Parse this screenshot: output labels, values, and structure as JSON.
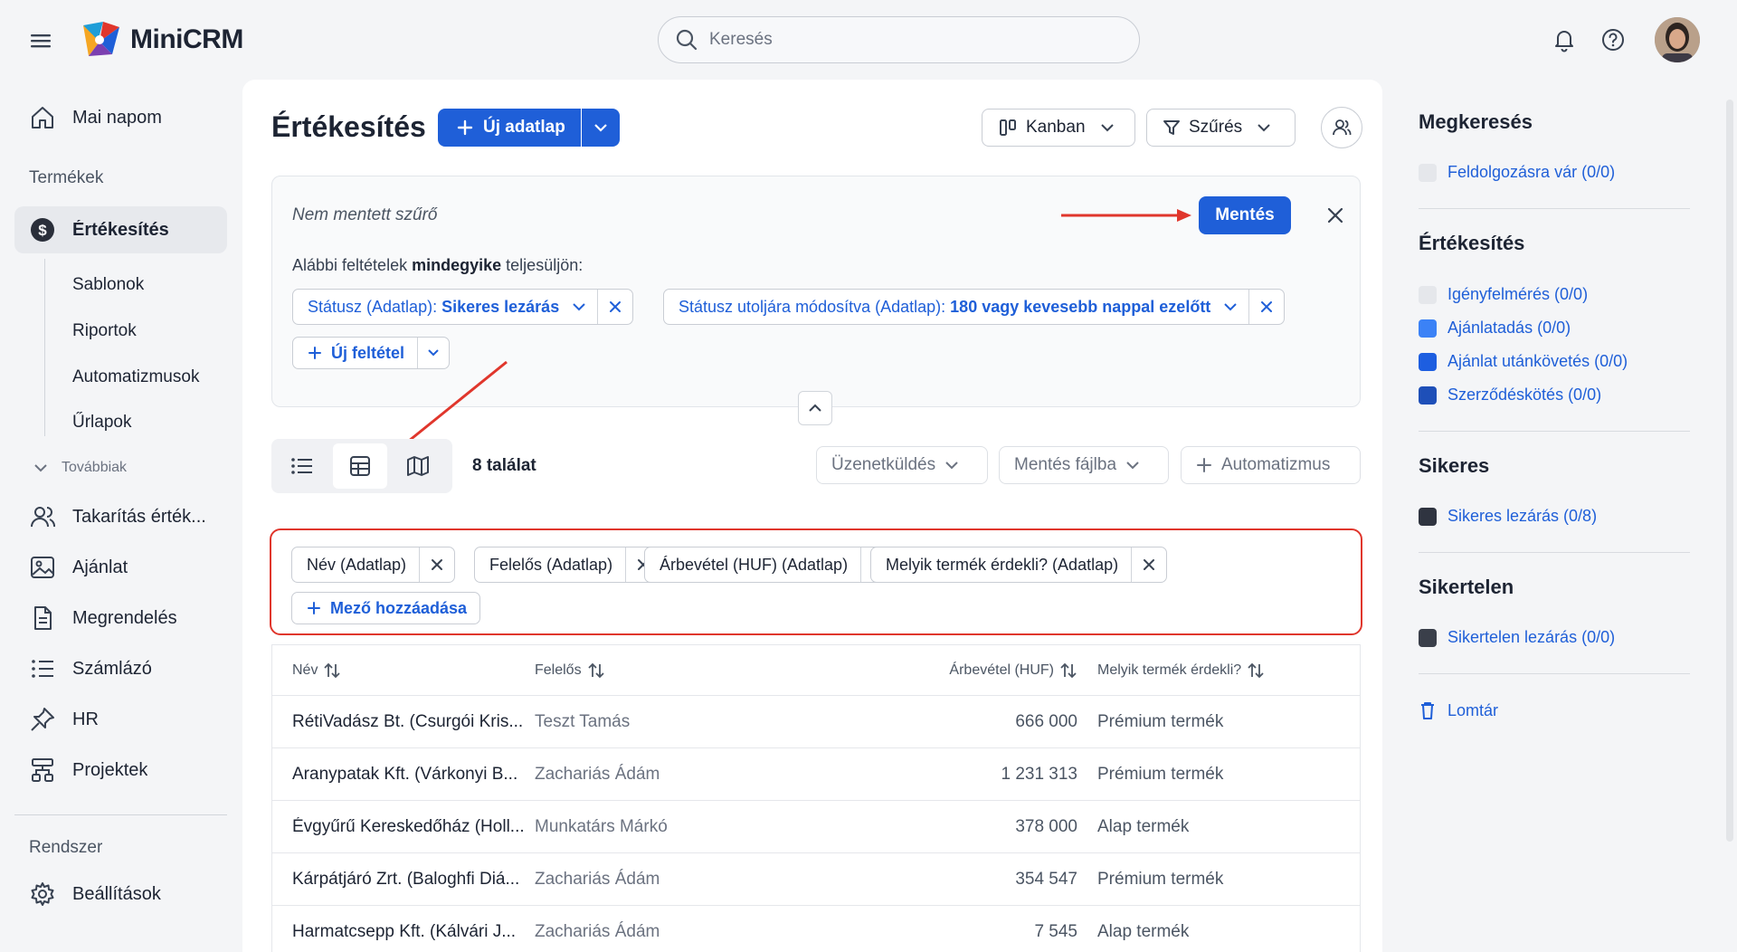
{
  "app": {
    "logo_text": "MiniCRM",
    "search_placeholder": "Keresés"
  },
  "sidebar": {
    "home": "Mai napom",
    "section_products": "Termékek",
    "active_item": "Értékesítés",
    "sub_items": [
      "Sablonok",
      "Riportok",
      "Automatizmusok",
      "Űrlapok"
    ],
    "more": "Továbbiak",
    "items": [
      "Takarítás érték...",
      "Ajánlat",
      "Megrendelés",
      "Számlázó",
      "HR",
      "Projektek"
    ],
    "section_system": "Rendszer",
    "settings": "Beállítások"
  },
  "main": {
    "title": "Értékesítés",
    "new_button": "Új adatlap",
    "kanban": "Kanban",
    "filter": "Szűrés",
    "filter_panel": {
      "unsaved": "Nem mentett szűrő",
      "save": "Mentés",
      "cond_prefix": "Alábbi feltételek",
      "cond_bold": "mindegyike",
      "cond_suffix": "teljesüljön:",
      "chips": [
        {
          "label": "Státusz (Adatlap):",
          "value": "Sikeres lezárás"
        },
        {
          "label": "Státusz utoljára módosítva (Adatlap):",
          "value": "180 vagy kevesebb nappal ezelőtt"
        }
      ],
      "new_condition": "Új feltétel"
    },
    "results": "8 találat",
    "actions": [
      "Üzenetküldés",
      "Mentés fájlba",
      "Automatizmus"
    ],
    "fields": [
      "Név (Adatlap)",
      "Felelős (Adatlap)",
      "Árbevétel (HUF) (Adatlap)",
      "Melyik termék érdekli? (Adatlap)"
    ],
    "add_field": "Mező hozzáadása",
    "table": {
      "headers": [
        "Név",
        "Felelős",
        "Árbevétel (HUF)",
        "Melyik termék érdekli?"
      ],
      "rows": [
        [
          "RétiVadász Bt. (Csurgói Kris...",
          "Teszt Tamás",
          "666 000",
          "Prémium termék"
        ],
        [
          "Aranypatak Kft. (Várkonyi B...",
          "Zachariás Ádám",
          "1 231 313",
          "Prémium termék"
        ],
        [
          "Évgyűrű Kereskedőház (Holl...",
          "Munkatárs Márkó",
          "378 000",
          "Alap termék"
        ],
        [
          "Kárpátjáró Zrt. (Baloghfi Diá...",
          "Zachariás Ádám",
          "354 547",
          "Prémium termék"
        ],
        [
          "Harmatcsepp Kft. (Kálvári J...",
          "Zachariás Ádám",
          "7 545",
          "Alap termék"
        ]
      ]
    }
  },
  "right_panel": {
    "groups": [
      {
        "title": "Megkeresés",
        "items": [
          {
            "label": "Feldolgozásra vár (0/0)",
            "color": "#e5e7eb"
          }
        ]
      },
      {
        "title": "Értékesítés",
        "items": [
          {
            "label": "Igényfelmérés (0/0)",
            "color": "#e5e7eb"
          },
          {
            "label": "Ajánlatadás (0/0)",
            "color": "#3b82f6"
          },
          {
            "label": "Ajánlat utánkövetés (0/0)",
            "color": "#1d5ee0"
          },
          {
            "label": "Szerződéskötés (0/0)",
            "color": "#1e4fb8"
          }
        ]
      },
      {
        "title": "Sikeres",
        "items": [
          {
            "label": "Sikeres lezárás (0/8)",
            "color": "#2f3440"
          }
        ]
      },
      {
        "title": "Sikertelen",
        "items": [
          {
            "label": "Sikertelen lezárás (0/0)",
            "color": "#3a3f4a"
          }
        ]
      }
    ],
    "trash": "Lomtár"
  },
  "colors": {
    "primary": "#1f5fd8",
    "highlight": "#e0362c"
  }
}
